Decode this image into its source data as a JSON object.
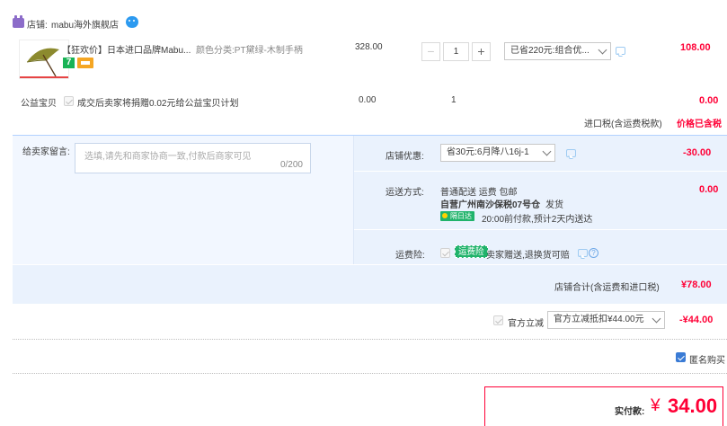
{
  "shop": {
    "label": "店铺:",
    "name": "mabu海外旗舰店"
  },
  "item": {
    "title": "【狂欢价】日本进口品牌Mabu...",
    "spec": "颜色分类:PT黛绿-木制手柄",
    "unit_price": "328.00",
    "quantity": "1",
    "promo_select": "已省220元:组合优...",
    "subtotal": "108.00",
    "tag_seven": "7"
  },
  "charity": {
    "label": "公益宝贝",
    "text": "成交后卖家将捐赠0.02元给公益宝贝计划",
    "price": "0.00",
    "qty": "1",
    "subtotal": "0.00"
  },
  "import_tax": {
    "label": "进口税(含运费税款)",
    "value": "价格已含税"
  },
  "message": {
    "label": "给卖家留言:",
    "placeholder": "选填,请先和商家协商一致,付款后商家可见",
    "counter": "0/200"
  },
  "shop_discount": {
    "label": "店铺优惠:",
    "select": "省30元:6月降八16j-1",
    "amount": "-30.00"
  },
  "shipping": {
    "label": "运送方式:",
    "line1": "普通配送 运费 包邮",
    "line2_bold": "自营广州南沙保税07号仓",
    "line2_tail": "发货",
    "badge": "隔日达",
    "delivery": "20:00前付款,预计2天内送达",
    "amount": "0.00"
  },
  "insurance": {
    "label": "运费险:",
    "badge": "运费险",
    "text": "卖家赠送,退换货可赔"
  },
  "shop_total": {
    "label": "店铺合计(含运费和进口税)",
    "amount": "¥78.00"
  },
  "official": {
    "label": "官方立减",
    "select": "官方立减抵扣¥44.00元",
    "amount": "-¥44.00"
  },
  "anonymous": {
    "label": "匿名购买"
  },
  "payment": {
    "label": "实付款:",
    "currency": "¥",
    "amount": "34.00"
  },
  "colors": {
    "accent_red": "#ff0036",
    "panel_blue": "#f2f7ff",
    "badge_green": "#20b36b"
  },
  "icons": [
    "shop-icon",
    "wangwang-icon",
    "chevron-down-icon",
    "chat-icon",
    "help-icon",
    "checkbox-icon"
  ]
}
